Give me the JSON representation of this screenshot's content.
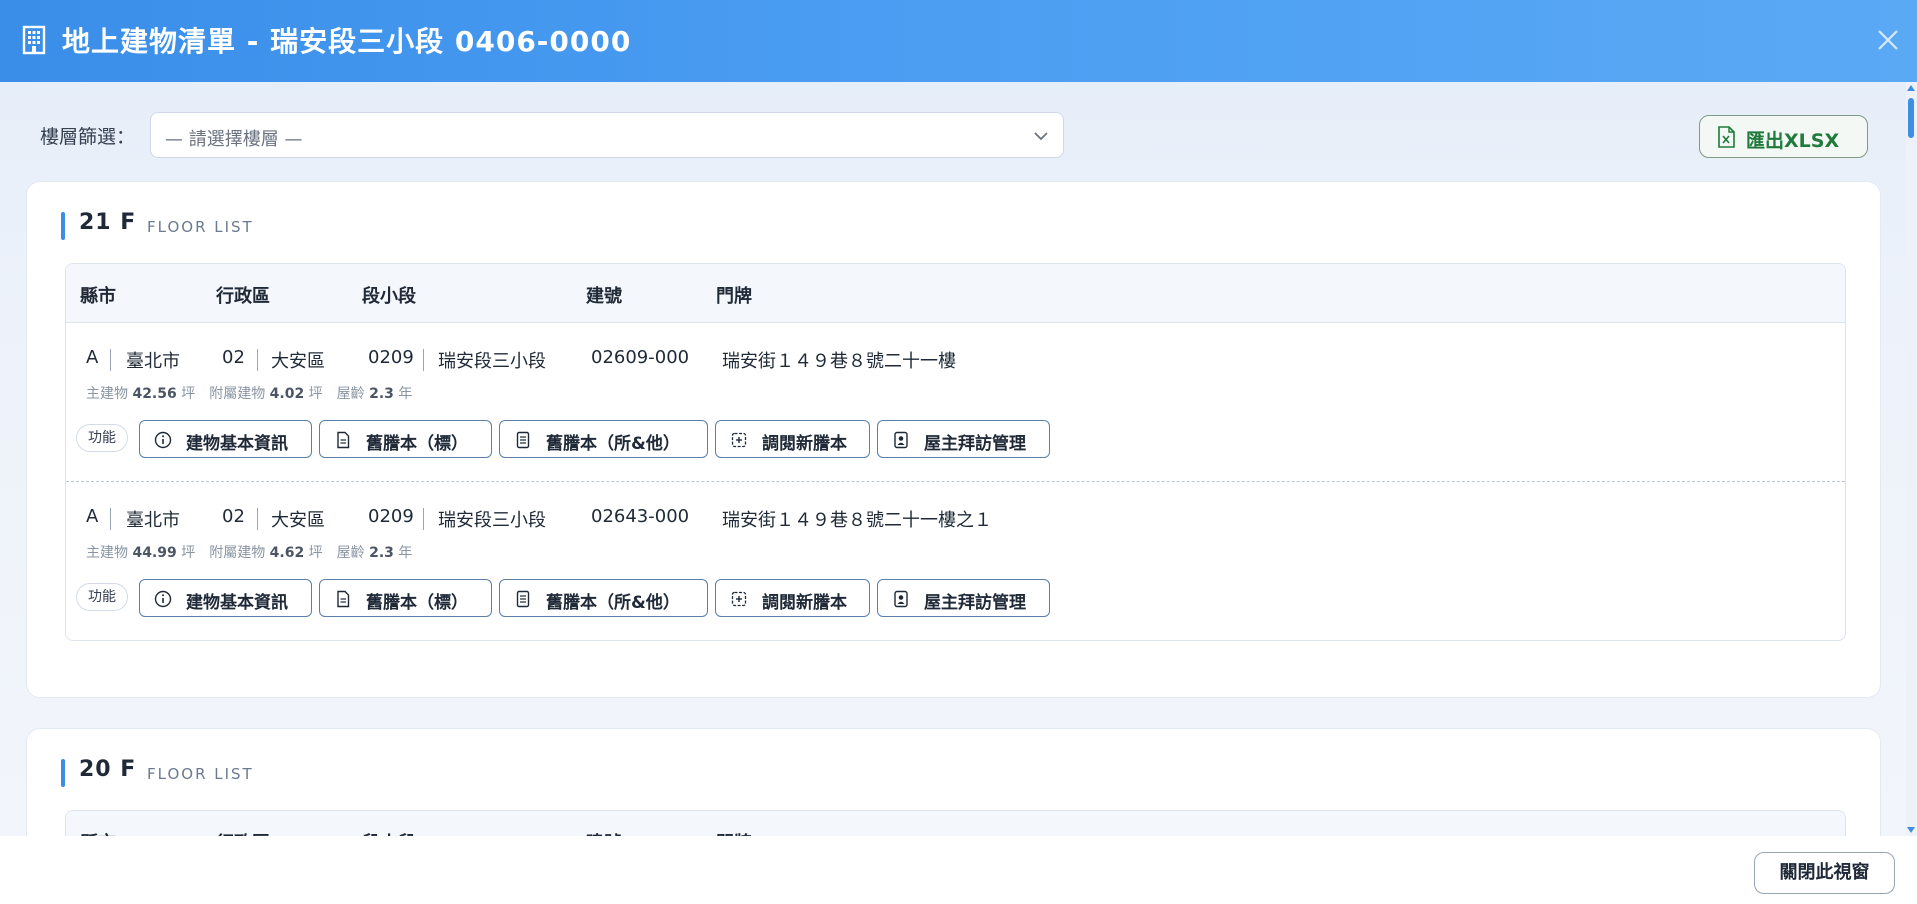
{
  "header": {
    "title": "地上建物清單 - 瑞安段三小段 0406-0000",
    "icon": "building-icon",
    "close_icon": "close-icon"
  },
  "filter": {
    "label": "樓層篩選：",
    "placeholder": "— 請選擇樓層 —"
  },
  "export": {
    "label": "匯出XLSX",
    "icon": "excel-file-icon",
    "color": "#1f7a3c"
  },
  "columns": [
    "縣市",
    "行政區",
    "段小段",
    "建號",
    "門牌"
  ],
  "floors": [
    {
      "floor": "21 F",
      "subtitle": "FLOOR LIST",
      "rows": [
        {
          "county_code": "A",
          "county": "臺北市",
          "district_code": "02",
          "district": "大安區",
          "section_code": "0209",
          "section": "瑞安段三小段",
          "build_no": "02609-000",
          "address": "瑞安街１４９巷８號二十一樓",
          "main_label": "主建物",
          "main_value": "42.56",
          "main_unit": "坪",
          "annex_label": "附屬建物",
          "annex_value": "4.02",
          "annex_unit": "坪",
          "age_label": "屋齡",
          "age_value": "2.3",
          "age_unit": "年"
        },
        {
          "county_code": "A",
          "county": "臺北市",
          "district_code": "02",
          "district": "大安區",
          "section_code": "0209",
          "section": "瑞安段三小段",
          "build_no": "02643-000",
          "address": "瑞安街１４９巷８號二十一樓之１",
          "main_label": "主建物",
          "main_value": "44.99",
          "main_unit": "坪",
          "annex_label": "附屬建物",
          "annex_value": "4.62",
          "annex_unit": "坪",
          "age_label": "屋齡",
          "age_value": "2.3",
          "age_unit": "年"
        }
      ]
    },
    {
      "floor": "20 F",
      "subtitle": "FLOOR LIST",
      "rows": []
    }
  ],
  "row_actions": {
    "func_label": "功能",
    "buttons": [
      {
        "label": "建物基本資訊",
        "icon": "info-icon"
      },
      {
        "label": "舊謄本（標）",
        "icon": "document-icon"
      },
      {
        "label": "舊謄本（所&他）",
        "icon": "document-lines-icon"
      },
      {
        "label": "調閱新謄本",
        "icon": "document-add-icon"
      },
      {
        "label": "屋主拜訪管理",
        "icon": "contact-card-icon"
      }
    ]
  },
  "footer": {
    "close_label": "關閉此視窗"
  },
  "colors": {
    "header_start": "#3a8ee8",
    "header_end": "#5aa9f5",
    "accent": "#3b8ee6",
    "export_green": "#1f7a3c"
  }
}
